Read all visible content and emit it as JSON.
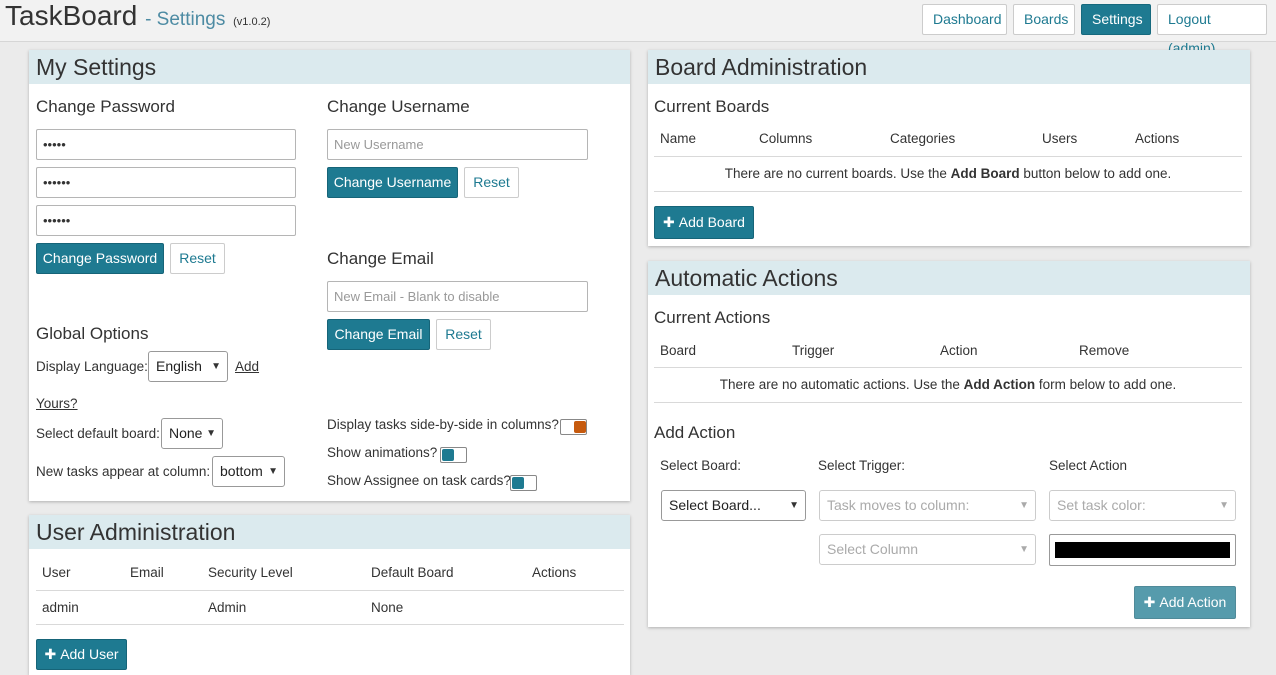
{
  "header": {
    "app_name": "TaskBoard",
    "page_subtitle": "- Settings",
    "version": "(v1.0.2)",
    "nav": {
      "dashboard": "Dashboard",
      "boards": "Boards",
      "settings": "Settings",
      "logout": "Logout (admin)"
    }
  },
  "my_settings": {
    "title": "My Settings",
    "change_password": {
      "heading": "Change Password",
      "current_value": "•••••",
      "new_value": "••••••",
      "confirm_value": "••••••",
      "submit": "Change Password",
      "reset": "Reset"
    },
    "change_username": {
      "heading": "Change Username",
      "placeholder": "New Username",
      "submit": "Change Username",
      "reset": "Reset"
    },
    "change_email": {
      "heading": "Change Email",
      "placeholder": "New Email - Blank to disable",
      "submit": "Change Email",
      "reset": "Reset"
    },
    "global_options": {
      "heading": "Global Options",
      "display_language_label": "Display Language:",
      "display_language_value": "English",
      "add_link": "Add",
      "yours_link": "Yours?",
      "default_board_label": "Select default board:",
      "default_board_value": "None",
      "new_tasks_label": "New tasks appear at column:",
      "new_tasks_value": "bottom",
      "side_by_side_label": "Display tasks side-by-side in columns?",
      "side_by_side_on": false,
      "animations_label": "Show animations?",
      "animations_on": true,
      "assignee_label": "Show Assignee on task cards?",
      "assignee_on": true
    }
  },
  "user_admin": {
    "title": "User Administration",
    "columns": [
      "User",
      "Email",
      "Security Level",
      "Default Board",
      "Actions"
    ],
    "rows": [
      {
        "user": "admin",
        "email": "",
        "security": "Admin",
        "default_board": "None",
        "actions": ""
      }
    ],
    "add_button": "Add User"
  },
  "board_admin": {
    "title": "Board Administration",
    "subheading": "Current Boards",
    "columns": [
      "Name",
      "Columns",
      "Categories",
      "Users",
      "Actions"
    ],
    "empty_pre": "There are no current boards. Use the ",
    "empty_bold": "Add Board",
    "empty_post": " button below to add one.",
    "add_button": "Add Board"
  },
  "auto_actions": {
    "title": "Automatic Actions",
    "subheading": "Current Actions",
    "columns": [
      "Board",
      "Trigger",
      "Action",
      "Remove"
    ],
    "empty_pre": "There are no automatic actions. Use the ",
    "empty_bold": "Add Action",
    "empty_post": " form below to add one.",
    "add_heading": "Add Action",
    "select_board_label": "Select Board:",
    "select_trigger_label": "Select Trigger:",
    "select_action_label": "Select Action",
    "board_select_value": "Select Board...",
    "trigger_select_value": "Task moves to column:",
    "action_select_value": "Set task color:",
    "column_select_value": "Select Column",
    "add_button": "Add Action"
  },
  "colors": {
    "primary": "#1e7a91",
    "panel_header": "#dbeaee",
    "toggle_off": "#c65a0e",
    "toggle_on": "#1e7a91"
  }
}
